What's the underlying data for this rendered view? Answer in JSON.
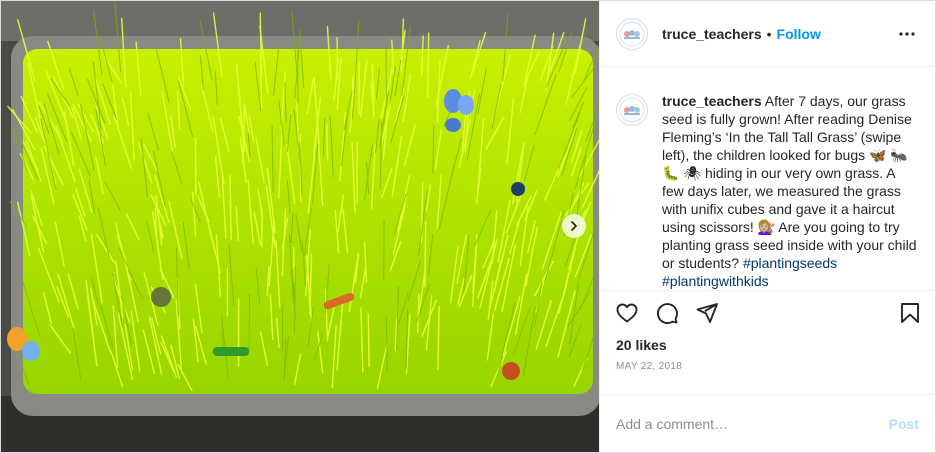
{
  "photo": {
    "alt_icon": "grass-photo"
  },
  "header": {
    "username": "truce_teachers",
    "separator": "•",
    "follow_label": "Follow",
    "more_icon": "more-horizontal-icon"
  },
  "caption": {
    "username": "truce_teachers",
    "text_1": " After 7 days, our grass seed is fully grown! After reading Denise Fleming’s ‘In the Tall Tall Grass’ (swipe left), the children looked for bugs 🦋 🐜 🐛 🕷 hiding in our very own grass. A few days later, we measured the grass with unifix cubes and gave it a haircut using scissors! 💇🏼‍♀️ Are you going to try planting grass seed inside with your child or students? ",
    "hashtag_1": "#plantingseeds",
    "space": " ",
    "hashtag_2": "#plantingwithkids"
  },
  "actions": {
    "like_icon": "heart-icon",
    "comment_icon": "comment-icon",
    "share_icon": "share-icon",
    "save_icon": "bookmark-icon"
  },
  "likes_text": "20 likes",
  "date_text": "MAY 22, 2018",
  "comment": {
    "placeholder": "Add a comment…",
    "post_label": "Post"
  }
}
